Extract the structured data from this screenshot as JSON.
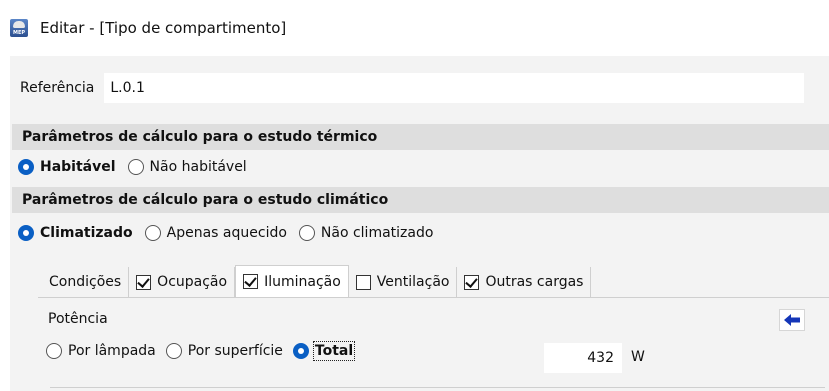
{
  "window": {
    "title": "Editar - [Tipo de compartimento]",
    "icon": "mep-app-icon",
    "icon_text": "MEP"
  },
  "reference": {
    "label": "Referência",
    "value": "L.0.1"
  },
  "thermal": {
    "header": "Parâmetros de cálculo para o estudo térmico",
    "options": [
      {
        "label": "Habitável",
        "checked": true
      },
      {
        "label": "Não habitável",
        "checked": false
      }
    ]
  },
  "climatic": {
    "header": "Parâmetros de cálculo para o estudo climático",
    "options": [
      {
        "label": "Climatizado",
        "checked": true
      },
      {
        "label": "Apenas aquecido",
        "checked": false
      },
      {
        "label": "Não climatizado",
        "checked": false
      }
    ]
  },
  "tabs": [
    {
      "label": "Condições",
      "has_checkbox": false,
      "checked": false,
      "active": false
    },
    {
      "label": "Ocupação",
      "has_checkbox": true,
      "checked": true,
      "active": false
    },
    {
      "label": "Iluminação",
      "has_checkbox": true,
      "checked": true,
      "active": true
    },
    {
      "label": "Ventilação",
      "has_checkbox": true,
      "checked": false,
      "active": false
    },
    {
      "label": "Outras cargas",
      "has_checkbox": true,
      "checked": true,
      "active": false
    }
  ],
  "lighting": {
    "section_label": "Potência",
    "options": [
      {
        "label": "Por lâmpada",
        "checked": false
      },
      {
        "label": "Por superfície",
        "checked": false
      },
      {
        "label": "Total",
        "checked": true
      }
    ],
    "value": "432",
    "unit": "W",
    "back_button_icon": "left-arrow-icon"
  },
  "colors": {
    "accent": "#0a5fc4",
    "arrow": "#1436b8",
    "panel": "#f3f3f3",
    "section": "#dedede"
  }
}
